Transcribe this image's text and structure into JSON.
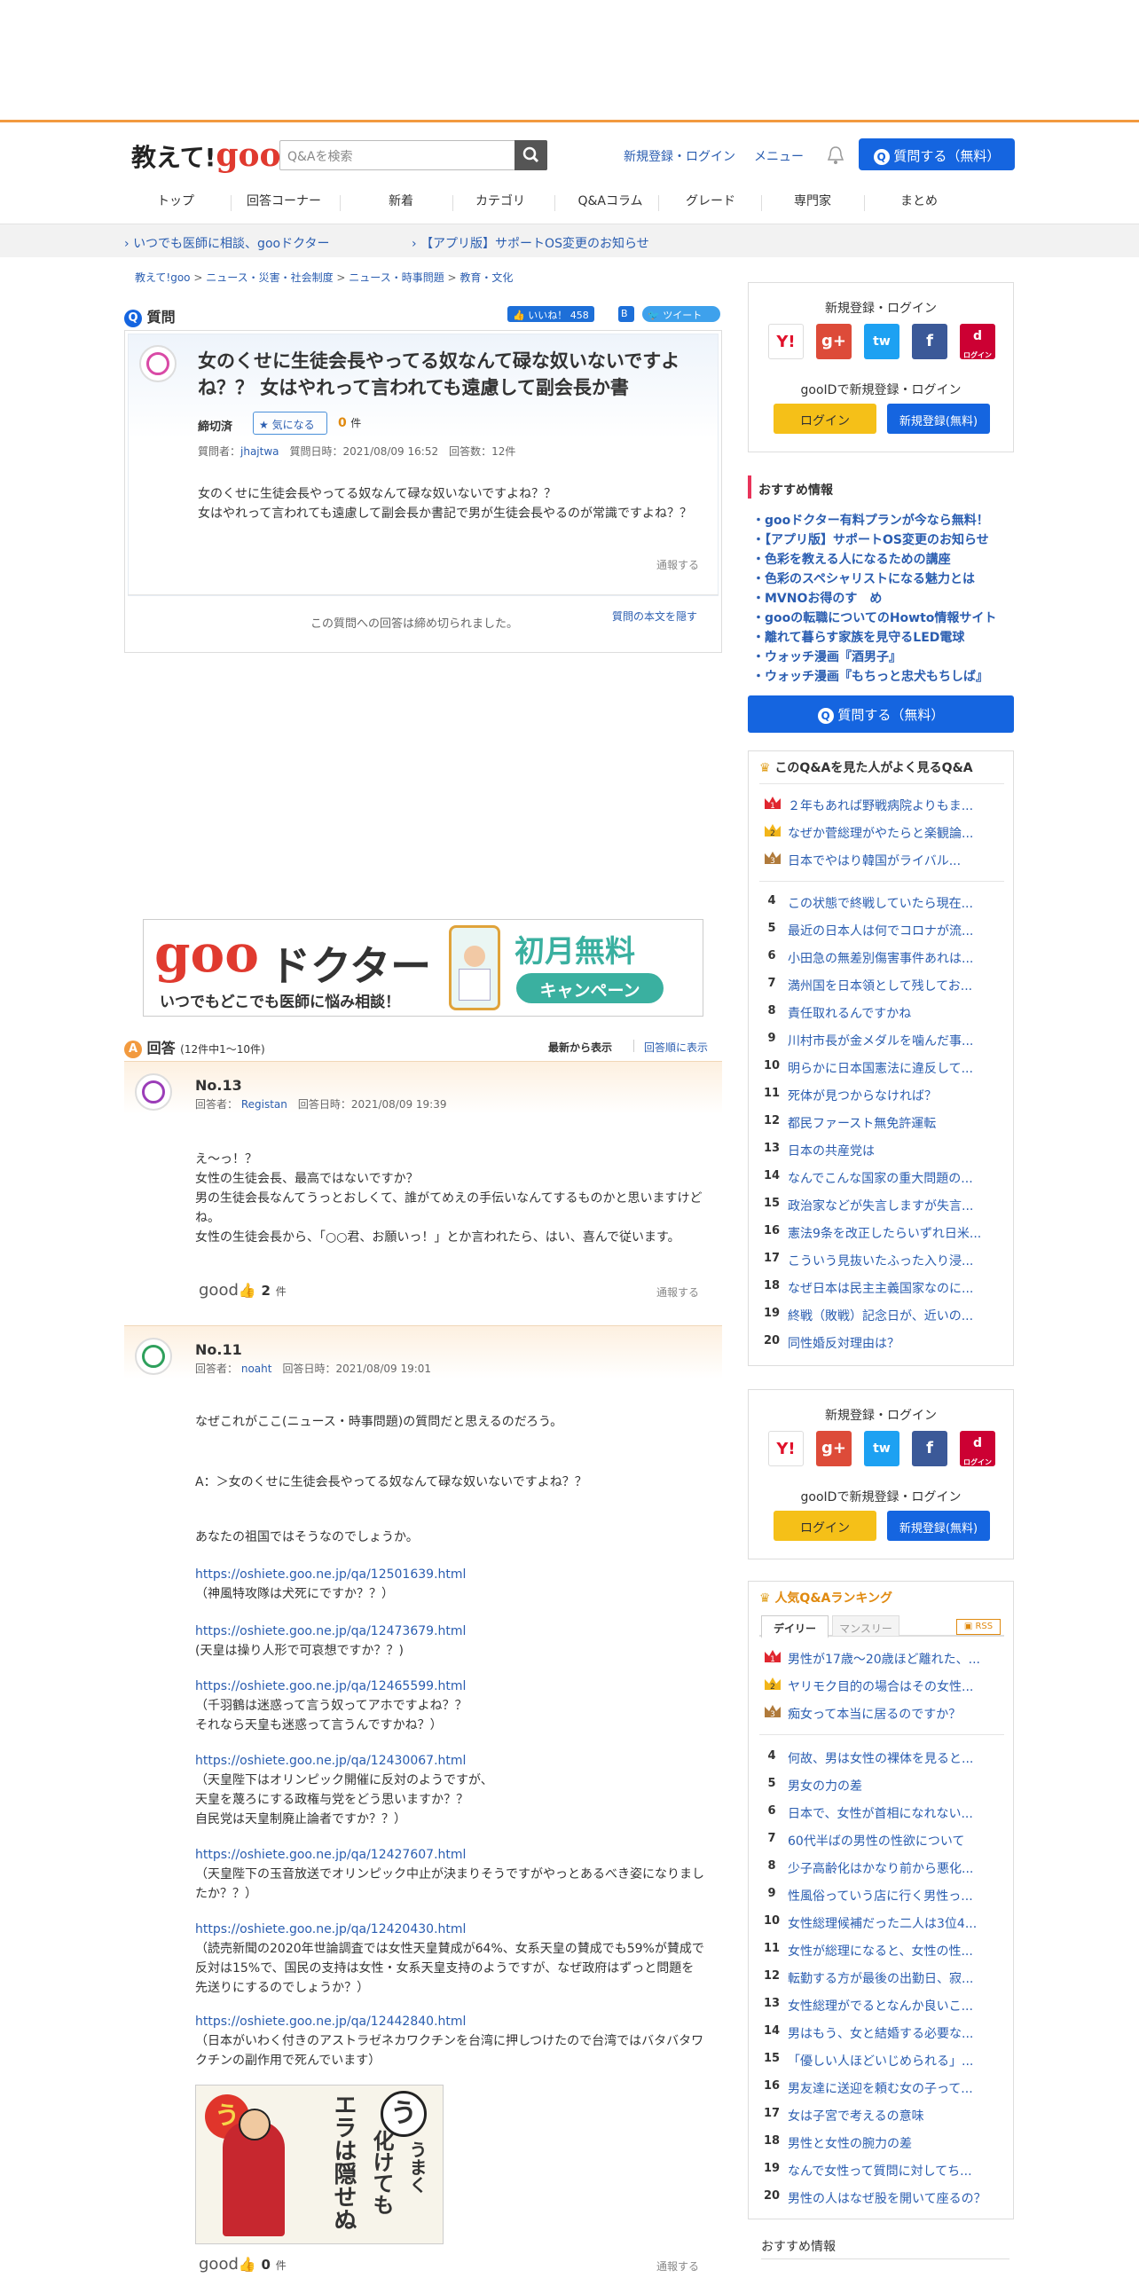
{
  "header": {
    "logo_text": "教えて!",
    "logo_brand": "goo",
    "search_placeholder": "Q&Aを検索",
    "signup_link": "新規登録・ログイン",
    "menu_link": "メニュー",
    "ask_button": "質問する（無料）"
  },
  "nav": [
    "トップ",
    "回答コーナー",
    "新着",
    "カテゴリ",
    "Q&Aコラム",
    "グレード",
    "専門家",
    "まとめ"
  ],
  "notices": [
    "いつでも医師に相談、gooドクター",
    "【アプリ版】サポートOS変更のお知らせ"
  ],
  "breadcrumb": [
    "教えて!goo",
    "ニュース・災害・社会制度",
    "ニュース・時事問題",
    "教育・文化"
  ],
  "question": {
    "section_label": "質問",
    "like_label": "いいね！",
    "like_count": "458",
    "tweet_label": "ツイート",
    "title": "女のくせに生徒会長やってる奴なんて碌な奴いないですよね？？ 女はやれって言われても遠慮して副会長か書",
    "status": "締切済",
    "watch_label": "気になる",
    "watch_count": "0",
    "watch_unit": "件",
    "asker_label": "質問者：",
    "asker": "jhajtwa",
    "date_label": "質問日時：2021/08/09 16:52",
    "answers_label": "回答数：12件",
    "body_line1": "女のくせに生徒会長やってる奴なんて碌な奴いないですよね？？",
    "body_line2": "女はやれって言われても遠慮して副会長か書記で男が生徒会長やるのが常識ですよね？？",
    "report": "通報する",
    "closed_note": "この質問への回答は締め切られました。",
    "hide_body": "質問の本文を隠す"
  },
  "ad_banner": {
    "brand": "goo",
    "brand2": "ドクター",
    "tagline": "いつでもどこでも医師に悩み相談！",
    "promo": "初月無料",
    "promo2": "キャンペーン"
  },
  "answers_header": {
    "label": "回答",
    "count": "(12件中1～10件)",
    "sort_new": "最新から表示",
    "sort_old": "回答順に表示"
  },
  "answers": [
    {
      "no": "No.13",
      "answerer_label": "回答者：",
      "answerer": "Registan",
      "date": "回答日時：2021/08/09 19:39",
      "lines": [
        "え～っ！？",
        "女性の生徒会長、最高ではないですか？",
        "男の生徒会長なんてうっとおしくて、誰がてめえの手伝いなんてするものかと思いますけどね。",
        "女性の生徒会長から、「○○君、お願いっ！」とか言われたら、はい、喜んで従います。"
      ],
      "good": "good",
      "good_count": "2",
      "good_unit": "件",
      "report": "通報する"
    },
    {
      "no": "No.11",
      "answerer_label": "回答者：",
      "answerer": "noaht",
      "date": "回答日時：2021/08/09 19:01",
      "intro": "なぜこれがここ(ニュース・時事問題)の質問だと思えるのだろう。",
      "quote": "A：＞女のくせに生徒会長やってる奴なんて碌な奴いないですよね？？",
      "para": "あなたの祖国ではそうなのでしょうか。",
      "links": [
        {
          "url": "https://oshiete.goo.ne.jp/qa/12501639.html",
          "note": [
            "（神風特攻隊は犬死にですか？？）"
          ]
        },
        {
          "url": "https://oshiete.goo.ne.jp/qa/12473679.html",
          "note": [
            "(天皇は操り人形で可哀想ですか？？)"
          ]
        },
        {
          "url": "https://oshiete.goo.ne.jp/qa/12465599.html",
          "note": [
            "（千羽鶴は迷惑って言う奴ってアホですよね？？",
            "それなら天皇も迷惑って言うんですかね？）"
          ]
        },
        {
          "url": "https://oshiete.goo.ne.jp/qa/12430067.html",
          "note": [
            "（天皇陛下はオリンピック開催に反対のようですが、",
            "天皇を蔑ろにする政権与党をどう思いますか？？",
            "自民党は天皇制廃止論者ですか？？）"
          ]
        },
        {
          "url": "https://oshiete.goo.ne.jp/qa/12427607.html",
          "note": [
            "（天皇陛下の玉音放送でオリンピック中止が決まりそうですがやっとあるべき姿になりましたか？？）"
          ]
        },
        {
          "url": "https://oshiete.goo.ne.jp/qa/12420430.html",
          "note": [
            "（読売新聞の2020年世論調査では女性天皇賛成が64%、女系天皇の賛成でも59%が賛成で反対は15%で、国民の支持は女性・女系天皇支持のようですが、なぜ政府はずっと問題を先送りにするのでしょうか？）"
          ]
        },
        {
          "url": "https://oshiete.goo.ne.jp/qa/12442840.html",
          "note": [
            "（日本がいわく付きのアストラゼネカワクチンを台湾に押しつけたので台湾ではバタバタワクチンの副作用で死んでいます）"
          ]
        }
      ],
      "card_char": "う",
      "card_text1": "うまく",
      "card_text2": "化けても",
      "card_text3": "エラは隠せぬ",
      "good": "good",
      "good_count": "0",
      "good_unit": "件",
      "report": "通報する"
    }
  ],
  "sidebar": {
    "login_title": "新規登録・ログイン",
    "social": [
      "Y!",
      "g+",
      "tw",
      "f",
      "d"
    ],
    "docomo_label": "ログイン",
    "gooid_text": "gooIDで新規登録・ログイン",
    "login_btn": "ログイン",
    "signup_btn": "新規登録(無料)",
    "recommend_title": "おすすめ情報",
    "recommend": [
      "gooドクター有料プランが今なら無料！",
      "【アプリ版】サポートOS変更のお知らせ",
      "色彩を教える人になるための講座",
      "色彩のスペシャリストになる魅力とは",
      "MVNOお得のす　め",
      "gooの転職についてのHowto情報サイト",
      "離れて暮らす家族を見守るLED電球",
      "ウォッチ漫画『酒男子』",
      "ウォッチ漫画『もちっと忠犬もちしば』"
    ],
    "ask_button": "質問する（無料）",
    "related_title": "このQ&Aを見た人がよく見るQ&A",
    "related": [
      "２年もあれば野戦病院よりもま...",
      "なぜか菅総理がやたらと楽観論...",
      "日本でやはり韓国がライバル...",
      "この状態で終戦していたら現在...",
      "最近の日本人は何でコロナが流...",
      "小田急の無差別傷害事件あれは...",
      "満州国を日本領として残してお...",
      "責任取れるんですかね",
      "川村市長が金メダルを噛んだ事...",
      "明らかに日本国憲法に違反して...",
      "死体が見つからなければ？",
      "都民ファースト無免許運転",
      "日本の共産党は",
      "なんでこんな国家の重大問題の...",
      "政治家などが失言しますが失言...",
      "憲法9条を改正したらいずれ日米...",
      "こういう見抜いたふった入り浸...",
      "なぜ日本は民主主義国家なのに...",
      "終戦（敗戦）記念日が、近いの...",
      "同性婚反対理由は？"
    ],
    "login2_title": "新規登録・ログイン",
    "gooid_text2": "gooIDで新規登録・ログイン",
    "ranking_title": "人気Q&Aランキング",
    "ranking_tab_daily": "デイリー",
    "ranking_tab_monthly": "マンスリー",
    "rss": "RSS",
    "ranking": [
      "男性が17歳～20歳ほど離れた、...",
      "ヤリモク目的の場合はその女性...",
      "痴女って本当に居るのですか？",
      "何故、男は女性の裸体を見ると...",
      "男女の力の差",
      "日本で、女性が首相になれない...",
      "60代半ばの男性の性欲について",
      "少子高齢化はかなり前から悪化...",
      "性風俗っていう店に行く男性っ...",
      "女性総理候補だった二人は3位4...",
      "女性が総理になると、女性の性...",
      "転勤する方が最後の出勤日、寂...",
      "女性総理がでるとなんか良いこ...",
      "男はもう、女と結婚する必要な...",
      "「優しい人ほどいじめられる」...",
      "男友達に送迎を頼む女の子って...",
      "女は子宮で考えるの意味",
      "男性と女性の腕力の差",
      "なんで女性って質問に対してち...",
      "男性の人はなぜ股を開いて座るの？"
    ],
    "recommend2_title": "おすすめ情報"
  },
  "colors": {
    "accent": "#1565e0",
    "orange": "#f29a3f",
    "link": "#2a5db0"
  }
}
